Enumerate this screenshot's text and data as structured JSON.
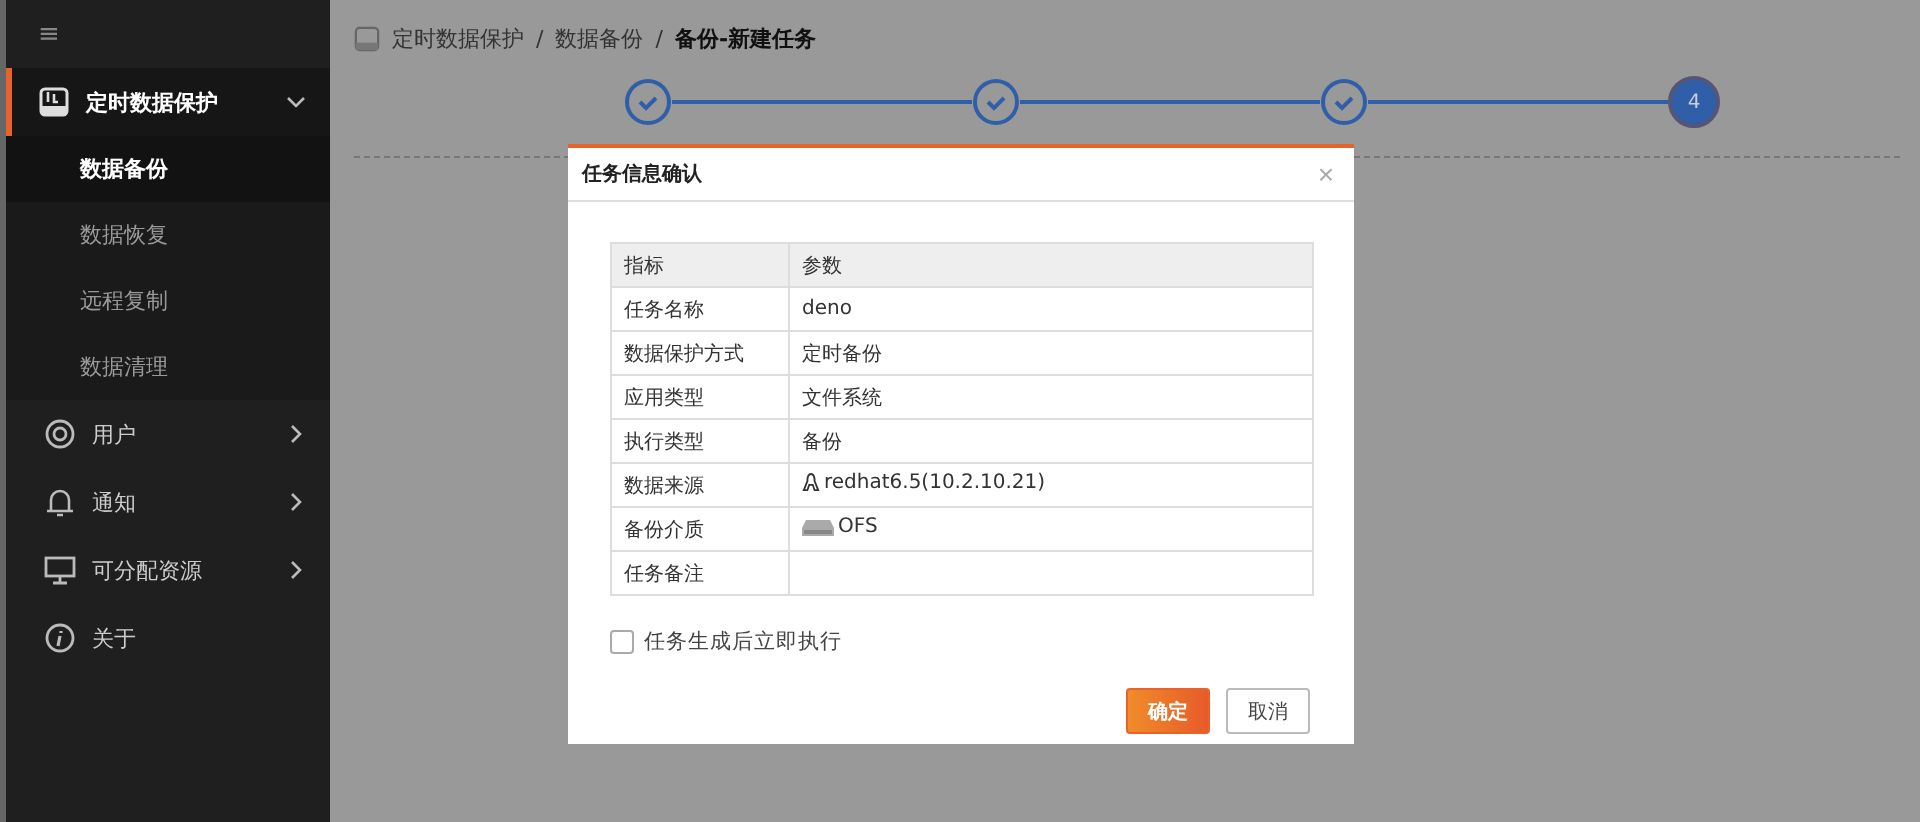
{
  "sidebar": {
    "menu_glyph": "≡",
    "items": [
      {
        "label": "定时数据保护",
        "kind": "drive",
        "expanded": true,
        "selected": true,
        "children": [
          {
            "label": "数据备份",
            "selected": true
          },
          {
            "label": "数据恢复",
            "selected": false
          },
          {
            "label": "远程复制",
            "selected": false
          },
          {
            "label": "数据清理",
            "selected": false
          }
        ]
      },
      {
        "label": "用户",
        "kind": "user",
        "expanded": false,
        "selected": false
      },
      {
        "label": "通知",
        "kind": "bell",
        "expanded": false,
        "selected": false
      },
      {
        "label": "可分配资源",
        "kind": "monitor",
        "expanded": false,
        "selected": false
      },
      {
        "label": "关于",
        "kind": "info",
        "selected": false
      }
    ]
  },
  "breadcrumb": [
    {
      "label": "定时数据保护"
    },
    {
      "separator": "/",
      "label": "数据备份"
    },
    {
      "separator": "/",
      "label": "备份-新建任务"
    }
  ],
  "steps": [
    {
      "done": true
    },
    {
      "done": true
    },
    {
      "done": true
    },
    {
      "done": false,
      "label": "4"
    }
  ],
  "dialog": {
    "title": "任务信息确认",
    "close": "×",
    "table": {
      "columns": [
        "指标",
        "参数"
      ],
      "rows": [
        {
          "key": "任务名称",
          "value": "deno"
        },
        {
          "key": "数据保护方式",
          "value": "定时备份"
        },
        {
          "key": "应用类型",
          "value": "文件系统"
        },
        {
          "key": "执行类型",
          "value": "备份"
        },
        {
          "key": "数据来源",
          "value": "redhat6.5(10.2.10.21)",
          "kind": "linux"
        },
        {
          "key": "备份介质",
          "value": "OFS",
          "kind": "disk"
        },
        {
          "key": "任务备注"
        }
      ]
    },
    "checkbox": {
      "label": "任务生成后立即执行",
      "checked": false
    },
    "buttons": [
      {
        "label": "确定",
        "kind": "primary"
      },
      {
        "label": "取消",
        "kind": "default"
      }
    ]
  }
}
